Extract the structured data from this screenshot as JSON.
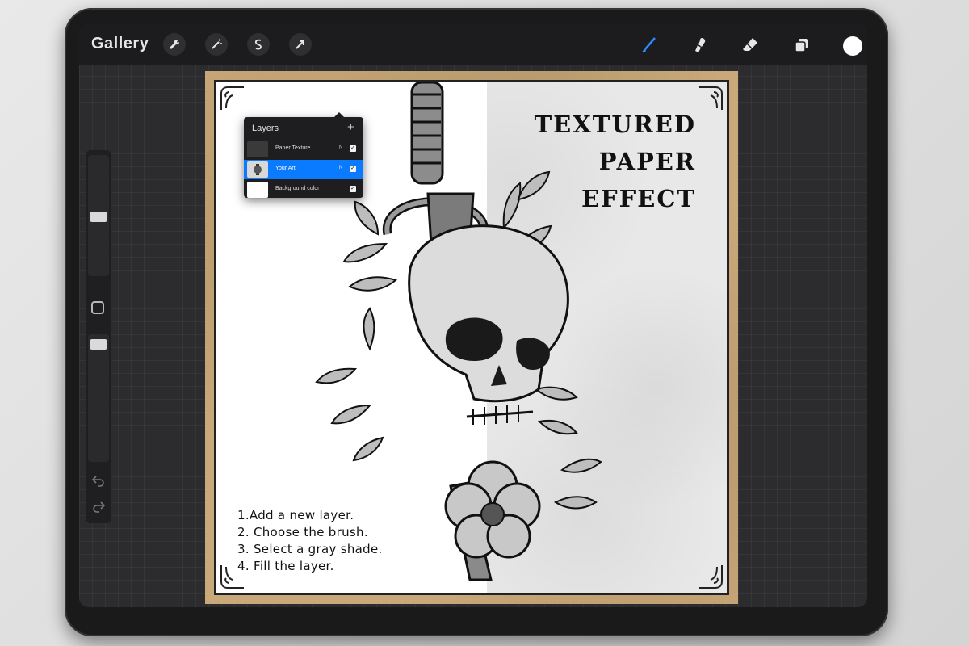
{
  "topbar": {
    "gallery_label": "Gallery",
    "left_tools": [
      "wrench-icon",
      "magic-wand-icon",
      "selection-icon",
      "transform-arrow-icon"
    ],
    "right_tools": [
      "brush-icon",
      "smudge-icon",
      "eraser-icon",
      "layers-icon"
    ],
    "active_tool": "brush-icon",
    "accent_color": "#2f8bff",
    "current_color": "#ffffff"
  },
  "sidebar": {
    "brush_size_level": 0.45,
    "opacity_level": 0.95,
    "undo_icon": "undo-icon",
    "redo_icon": "redo-icon"
  },
  "layers_panel": {
    "title": "Layers",
    "add_label": "+",
    "layers": [
      {
        "name": "Paper Texture",
        "mode": "N",
        "visible": true,
        "selected": false
      },
      {
        "name": "Your Art",
        "mode": "N",
        "visible": true,
        "selected": true
      },
      {
        "name": "Background color",
        "mode": "",
        "visible": true,
        "selected": false
      }
    ],
    "selected_color": "#0a7aff"
  },
  "artwork": {
    "title_lines": [
      "TEXTURED",
      "PAPER",
      "EFFECT"
    ],
    "steps": [
      "1.Add a new layer.",
      "2. Choose the brush.",
      "3. Select a gray shade.",
      "4. Fill the layer."
    ]
  }
}
